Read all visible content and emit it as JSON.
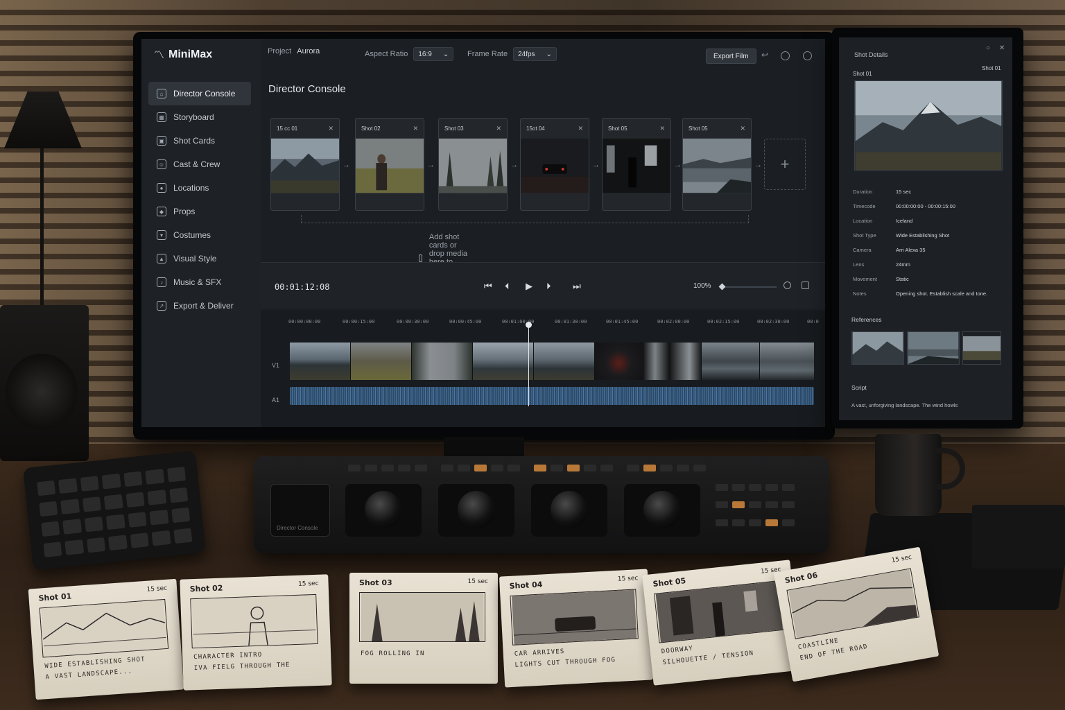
{
  "app": {
    "name": "MiniMax",
    "project_label": "Project",
    "project_value": "Aurora",
    "aspect_label": "Aspect Ratio",
    "aspect_value": "16:9",
    "framerate_label": "Frame Rate",
    "framerate_value": "24fps",
    "export_label": "Export Film",
    "page_title": "Director Console"
  },
  "sidebar": {
    "items": [
      {
        "label": "Director Console",
        "icon": "home-icon"
      },
      {
        "label": "Storyboard",
        "icon": "storyboard-icon"
      },
      {
        "label": "Shot Cards",
        "icon": "shot-cards-icon"
      },
      {
        "label": "Cast & Crew",
        "icon": "people-icon"
      },
      {
        "label": "Locations",
        "icon": "pin-icon"
      },
      {
        "label": "Props",
        "icon": "props-icon"
      },
      {
        "label": "Costumes",
        "icon": "shirt-icon"
      },
      {
        "label": "Visual Style",
        "icon": "image-icon"
      },
      {
        "label": "Music & SFX",
        "icon": "music-icon"
      },
      {
        "label": "Export & Deliver",
        "icon": "export-icon"
      }
    ]
  },
  "sequence": {
    "cards": [
      {
        "label": "15 cc 01"
      },
      {
        "label": "Shot 02"
      },
      {
        "label": "Shot 03"
      },
      {
        "label": "15ot 04"
      },
      {
        "label": "Shot 05"
      },
      {
        "label": "Shot 05"
      }
    ],
    "drop_hint": "Add shot cards or drop media here to build your sequence"
  },
  "transport": {
    "timecode": "00:01:12:08",
    "zoom": "100%"
  },
  "timeline": {
    "ticks": [
      "00:00:00:00",
      "00:00:15:00",
      "00:00:30:00",
      "00:00:45:00",
      "00:01:00:00",
      "00:01:30:00",
      "00:01:45:00",
      "00:02:00:00",
      "00:02:15:00",
      "00:02:30:00",
      "00:0"
    ],
    "track_video": "V1",
    "track_audio": "A1"
  },
  "shot_details": {
    "title": "Shot Details",
    "shot_left": "Shot 01",
    "shot_right": "Shot 01",
    "rows": [
      {
        "key": "Duration",
        "value": "15 sec"
      },
      {
        "key": "Timecode",
        "value": "00:00:00:00 - 00:00:15:00"
      },
      {
        "key": "Location",
        "value": "Iceland"
      },
      {
        "key": "Shot Type",
        "value": "Wide Establishing Shot"
      },
      {
        "key": "Camera",
        "value": "Arri Alexa 35"
      },
      {
        "key": "Lens",
        "value": "24mm"
      },
      {
        "key": "Movement",
        "value": "Static"
      },
      {
        "key": "Notes",
        "value": "Opening shot. Establish scale and tone."
      }
    ],
    "references_label": "References",
    "script_label": "Script",
    "script_text": "A vast, unforgiving landscape. The wind howls"
  },
  "hardware": {
    "console_label": "Director Console"
  },
  "paper_cards": [
    {
      "title": "Shot 01",
      "duration": "15 sec",
      "line1": "Wide establishing shot",
      "line2": "A vast landscape..."
    },
    {
      "title": "Shot 02",
      "duration": "15 sec",
      "line1": "Character intro",
      "line2": "Iva Fielg through the"
    },
    {
      "title": "Shot 03",
      "duration": "15 sec",
      "line1": "Fog rolling in",
      "line2": ""
    },
    {
      "title": "Shot 04",
      "duration": "15 sec",
      "line1": "Car arrives",
      "line2": "Lights cut through fog"
    },
    {
      "title": "Shot 05",
      "duration": "15 sec",
      "line1": "Doorway",
      "line2": "Silhouette / tension"
    },
    {
      "title": "Shot 06",
      "duration": "15 sec",
      "line1": "Coastline",
      "line2": "End of the road"
    }
  ],
  "colors": {
    "accent": "#30353c",
    "screen_bg": "#1b1f24",
    "audio_wave": "#3a5f84"
  }
}
